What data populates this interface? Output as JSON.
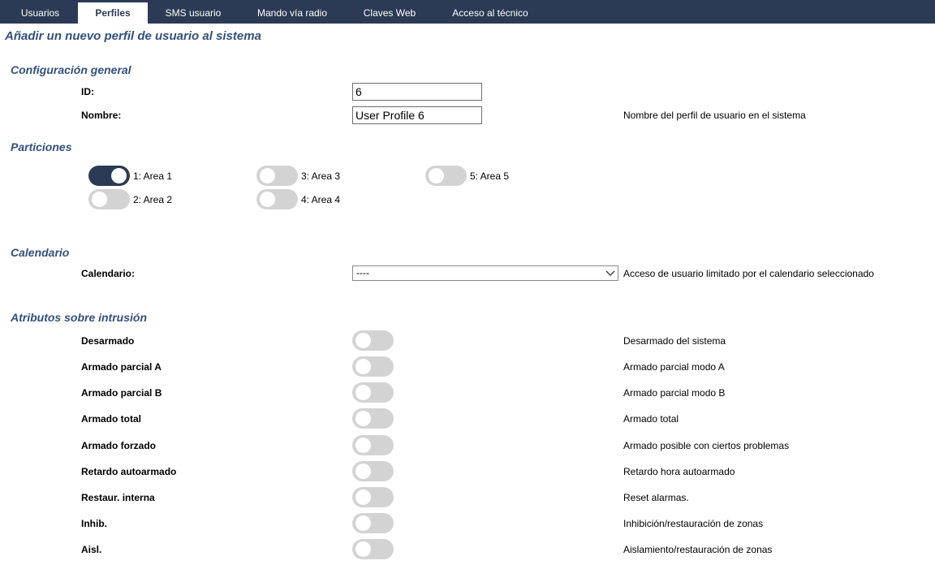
{
  "tabs": [
    {
      "label": "Usuarios",
      "active": false
    },
    {
      "label": "Perfiles",
      "active": true
    },
    {
      "label": "SMS usuario",
      "active": false
    },
    {
      "label": "Mando vía radio",
      "active": false
    },
    {
      "label": "Claves Web",
      "active": false
    },
    {
      "label": "Acceso al técnico",
      "active": false
    }
  ],
  "page_title": "Añadir un nuevo perfil de usuario al sistema",
  "general": {
    "title": "Configuración general",
    "id_label": "ID:",
    "id_value": "6",
    "name_label": "Nombre:",
    "name_value": "User Profile 6",
    "name_desc": "Nombre del perfil de usuario en el sistema"
  },
  "partitions": {
    "title": "Particiones",
    "areas": [
      {
        "label": "1: Area 1",
        "on": true
      },
      {
        "label": "2: Area 2",
        "on": false
      },
      {
        "label": "3: Area 3",
        "on": false
      },
      {
        "label": "4: Area 4",
        "on": false
      },
      {
        "label": "5: Area 5",
        "on": false
      }
    ]
  },
  "calendar": {
    "title": "Calendario",
    "label": "Calendario:",
    "selected": "----",
    "desc": "Acceso de usuario limitado por el calendario seleccionado"
  },
  "intrusion": {
    "title": "Atributos sobre intrusión",
    "rows": [
      {
        "label": "Desarmado",
        "desc": "Desarmado del sistema",
        "on": false
      },
      {
        "label": "Armado parcial A",
        "desc": "Armado parcial modo A",
        "on": false
      },
      {
        "label": "Armado parcial B",
        "desc": "Armado parcial modo B",
        "on": false
      },
      {
        "label": "Armado total",
        "desc": "Armado total",
        "on": false
      },
      {
        "label": "Armado forzado",
        "desc": "Armado posible con ciertos problemas",
        "on": false
      },
      {
        "label": "Retardo autoarmado",
        "desc": "Retardo hora autoarmado",
        "on": false
      },
      {
        "label": "Restaur. interna",
        "desc": "Reset alarmas.",
        "on": false
      },
      {
        "label": "Inhib.",
        "desc": "Inhibición/restauración de zonas",
        "on": false
      },
      {
        "label": "Aisl.",
        "desc": "Aislamiento/restauración de zonas",
        "on": false
      }
    ]
  },
  "colors": {
    "nav_bg": "#2b3a55",
    "heading": "#33507f",
    "toggle_off": "#d3d3d3",
    "toggle_on": "#2b3a55"
  },
  "icons": {
    "select_arrow": "chevron-down-icon"
  }
}
